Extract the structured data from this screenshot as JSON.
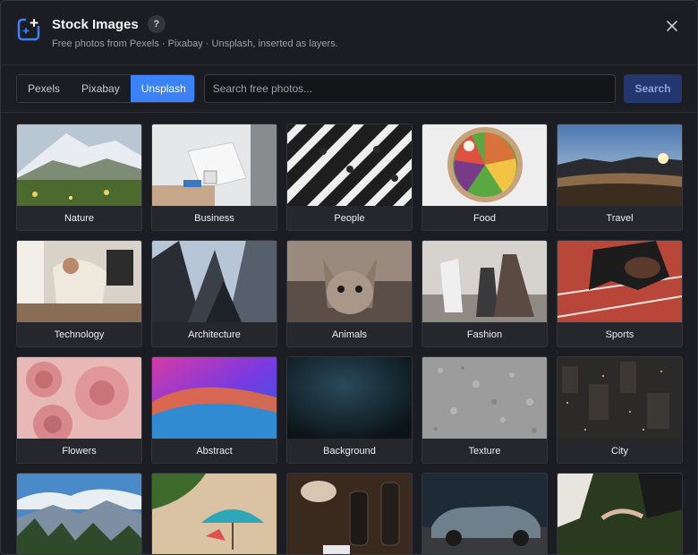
{
  "header": {
    "title": "Stock Images",
    "help": "?",
    "subtitle": "Free photos from Pexels · Pixabay · Unsplash, inserted as layers.",
    "logo_icon": "image-plus-icon",
    "close_icon": "close-icon"
  },
  "sources": {
    "tabs": [
      {
        "label": "Pexels",
        "active": false
      },
      {
        "label": "Pixabay",
        "active": false
      },
      {
        "label": "Unsplash",
        "active": true
      }
    ]
  },
  "search": {
    "placeholder": "Search free photos...",
    "value": "",
    "button_label": "Search"
  },
  "colors": {
    "accent": "#3b82f6",
    "search_button": "#24366e"
  },
  "categories": [
    {
      "label": "Nature"
    },
    {
      "label": "Business"
    },
    {
      "label": "People"
    },
    {
      "label": "Food"
    },
    {
      "label": "Travel"
    },
    {
      "label": "Technology"
    },
    {
      "label": "Architecture"
    },
    {
      "label": "Animals"
    },
    {
      "label": "Fashion"
    },
    {
      "label": "Sports"
    },
    {
      "label": "Flowers"
    },
    {
      "label": "Abstract"
    },
    {
      "label": "Background"
    },
    {
      "label": "Texture"
    },
    {
      "label": "City"
    },
    {
      "label": ""
    },
    {
      "label": ""
    },
    {
      "label": ""
    },
    {
      "label": ""
    },
    {
      "label": ""
    }
  ]
}
